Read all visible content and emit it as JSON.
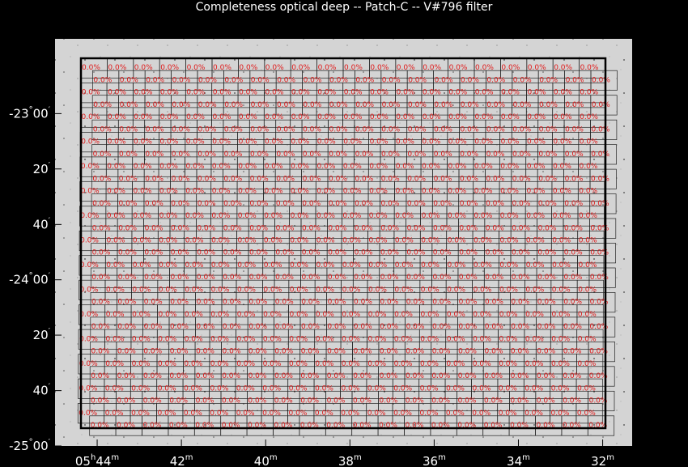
{
  "chart_data": {
    "type": "heatmap",
    "title": "Completeness optical deep -- Patch-C -- V#796 filter",
    "cell_value_label": "0.0%",
    "x_ticks": [
      {
        "value": 44,
        "label_main": "05",
        "label_sup1": "h",
        "label_mid": "44",
        "label_sup2": "m"
      },
      {
        "value": 42,
        "label_main": "42",
        "label_sup1": "",
        "label_mid": "",
        "label_sup2": "m"
      },
      {
        "value": 40,
        "label_main": "40",
        "label_sup1": "",
        "label_mid": "",
        "label_sup2": "m"
      },
      {
        "value": 38,
        "label_main": "38",
        "label_sup1": "",
        "label_mid": "",
        "label_sup2": "m"
      },
      {
        "value": 36,
        "label_main": "36",
        "label_sup1": "",
        "label_mid": "",
        "label_sup2": "m"
      },
      {
        "value": 34,
        "label_main": "34",
        "label_sup1": "",
        "label_mid": "",
        "label_sup2": "m"
      },
      {
        "value": 32,
        "label_main": "32",
        "label_sup1": "",
        "label_mid": "",
        "label_sup2": "m"
      }
    ],
    "y_ticks": [
      {
        "value": -23.0,
        "label_main": "-23",
        "label_sup1": "°",
        "label_mid": "00",
        "label_sup2": "′"
      },
      {
        "value": -23.333,
        "label_main": "20",
        "label_sup1": "",
        "label_mid": "",
        "label_sup2": "′"
      },
      {
        "value": -23.667,
        "label_main": "40",
        "label_sup1": "",
        "label_mid": "",
        "label_sup2": "′"
      },
      {
        "value": -24.0,
        "label_main": "-24",
        "label_sup1": "°",
        "label_mid": "00",
        "label_sup2": "′"
      },
      {
        "value": -24.333,
        "label_main": "20",
        "label_sup1": "",
        "label_mid": "",
        "label_sup2": "′"
      },
      {
        "value": -24.667,
        "label_main": "40",
        "label_sup1": "",
        "label_mid": "",
        "label_sup2": "′"
      },
      {
        "value": -25.0,
        "label_main": "-25",
        "label_sup1": "°",
        "label_mid": "00",
        "label_sup2": "′"
      }
    ],
    "xlim": [
      45.0,
      31.3
    ],
    "ylim": [
      -25.0,
      -22.55
    ],
    "grid": {
      "rows": 30,
      "cols": 20,
      "completeness_percent": 0.0
    },
    "colors": {
      "background": "#000000",
      "image": "#d6d6d6",
      "cell_border": "#222222",
      "cell_label": "#e01818",
      "text": "#ffffff"
    }
  }
}
